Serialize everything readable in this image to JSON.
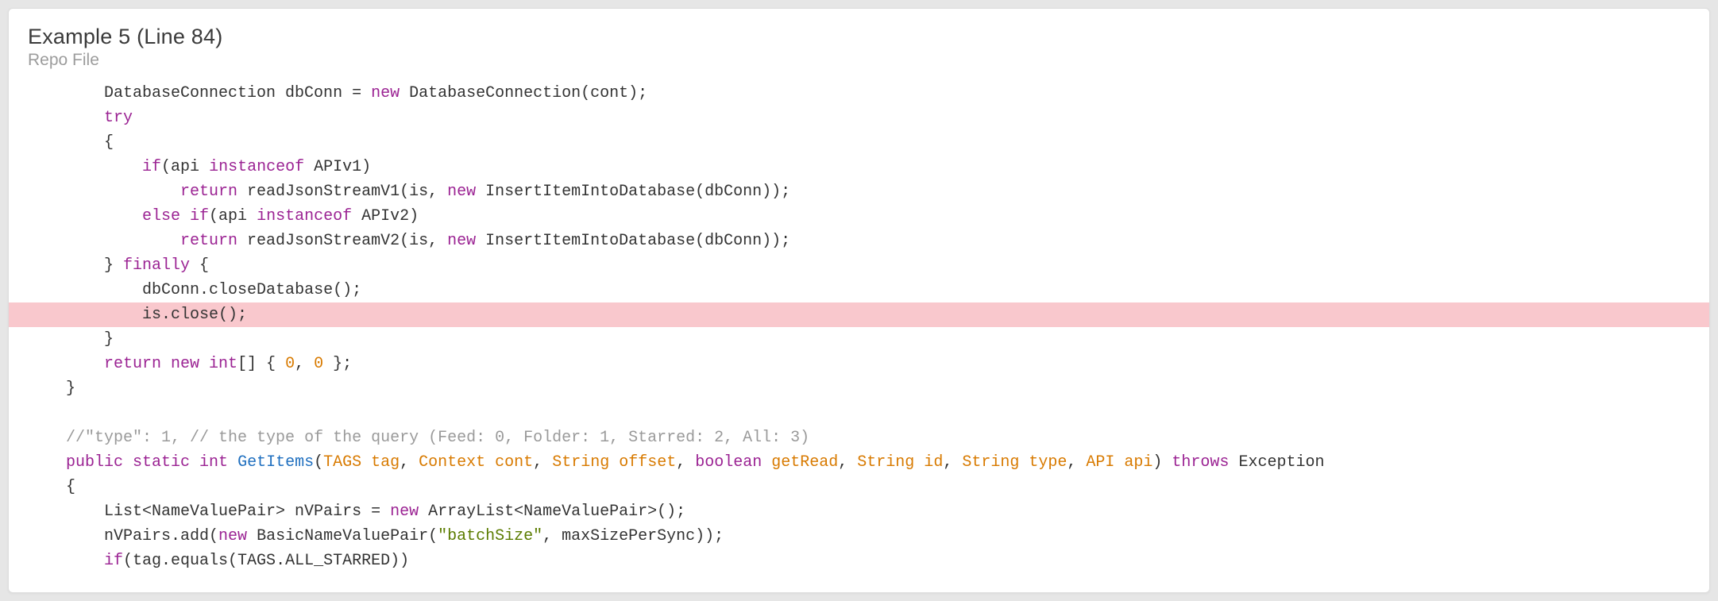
{
  "header": {
    "title": "Example 5 (Line 84)",
    "subtitle": "Repo File"
  },
  "code": {
    "lines": [
      {
        "indent": "        ",
        "highlight": false,
        "tokens": [
          {
            "t": "DatabaseConnection dbConn = ",
            "c": ""
          },
          {
            "t": "new",
            "c": "kw"
          },
          {
            "t": " DatabaseConnection(cont);",
            "c": ""
          }
        ]
      },
      {
        "indent": "        ",
        "highlight": false,
        "tokens": [
          {
            "t": "try",
            "c": "kw"
          }
        ]
      },
      {
        "indent": "        ",
        "highlight": false,
        "tokens": [
          {
            "t": "{",
            "c": ""
          }
        ]
      },
      {
        "indent": "            ",
        "highlight": false,
        "tokens": [
          {
            "t": "if",
            "c": "kw"
          },
          {
            "t": "(api ",
            "c": ""
          },
          {
            "t": "instanceof",
            "c": "kw"
          },
          {
            "t": " APIv1)",
            "c": ""
          }
        ]
      },
      {
        "indent": "                ",
        "highlight": false,
        "tokens": [
          {
            "t": "return",
            "c": "kw"
          },
          {
            "t": " readJsonStreamV1(is, ",
            "c": ""
          },
          {
            "t": "new",
            "c": "kw"
          },
          {
            "t": " InsertItemIntoDatabase(dbConn));",
            "c": ""
          }
        ]
      },
      {
        "indent": "            ",
        "highlight": false,
        "tokens": [
          {
            "t": "else if",
            "c": "kw"
          },
          {
            "t": "(api ",
            "c": ""
          },
          {
            "t": "instanceof",
            "c": "kw"
          },
          {
            "t": " APIv2)",
            "c": ""
          }
        ]
      },
      {
        "indent": "                ",
        "highlight": false,
        "tokens": [
          {
            "t": "return",
            "c": "kw"
          },
          {
            "t": " readJsonStreamV2(is, ",
            "c": ""
          },
          {
            "t": "new",
            "c": "kw"
          },
          {
            "t": " InsertItemIntoDatabase(dbConn));",
            "c": ""
          }
        ]
      },
      {
        "indent": "        ",
        "highlight": false,
        "tokens": [
          {
            "t": "} ",
            "c": ""
          },
          {
            "t": "finally",
            "c": "kw"
          },
          {
            "t": " {",
            "c": ""
          }
        ]
      },
      {
        "indent": "            ",
        "highlight": false,
        "tokens": [
          {
            "t": "dbConn.closeDatabase();",
            "c": ""
          }
        ]
      },
      {
        "indent": "            ",
        "highlight": true,
        "tokens": [
          {
            "t": "is.close();",
            "c": ""
          }
        ]
      },
      {
        "indent": "        ",
        "highlight": false,
        "tokens": [
          {
            "t": "}",
            "c": ""
          }
        ]
      },
      {
        "indent": "        ",
        "highlight": false,
        "tokens": [
          {
            "t": "return new int",
            "c": "kw"
          },
          {
            "t": "[] { ",
            "c": ""
          },
          {
            "t": "0",
            "c": "num"
          },
          {
            "t": ", ",
            "c": ""
          },
          {
            "t": "0",
            "c": "num"
          },
          {
            "t": " };",
            "c": ""
          }
        ]
      },
      {
        "indent": "    ",
        "highlight": false,
        "tokens": [
          {
            "t": "}",
            "c": ""
          }
        ]
      },
      {
        "indent": "",
        "highlight": false,
        "tokens": []
      },
      {
        "indent": "    ",
        "highlight": false,
        "tokens": [
          {
            "t": "//\"type\": 1, // the type of the query (Feed: 0, Folder: 1, Starred: 2, All: 3)",
            "c": "comment"
          }
        ]
      },
      {
        "indent": "    ",
        "highlight": false,
        "tokens": [
          {
            "t": "public static int",
            "c": "kw"
          },
          {
            "t": " ",
            "c": ""
          },
          {
            "t": "GetItems",
            "c": "func"
          },
          {
            "t": "(",
            "c": ""
          },
          {
            "t": "TAGS tag",
            "c": "param"
          },
          {
            "t": ", ",
            "c": ""
          },
          {
            "t": "Context cont",
            "c": "param"
          },
          {
            "t": ", ",
            "c": ""
          },
          {
            "t": "String offset",
            "c": "param"
          },
          {
            "t": ", ",
            "c": ""
          },
          {
            "t": "boolean",
            "c": "kw"
          },
          {
            "t": " ",
            "c": ""
          },
          {
            "t": "getRead",
            "c": "param"
          },
          {
            "t": ", ",
            "c": ""
          },
          {
            "t": "String id",
            "c": "param"
          },
          {
            "t": ", ",
            "c": ""
          },
          {
            "t": "String type",
            "c": "param"
          },
          {
            "t": ", ",
            "c": ""
          },
          {
            "t": "API api",
            "c": "param"
          },
          {
            "t": ") ",
            "c": ""
          },
          {
            "t": "throws",
            "c": "kw"
          },
          {
            "t": " Exception",
            "c": ""
          }
        ]
      },
      {
        "indent": "    ",
        "highlight": false,
        "tokens": [
          {
            "t": "{",
            "c": ""
          }
        ]
      },
      {
        "indent": "        ",
        "highlight": false,
        "tokens": [
          {
            "t": "List<NameValuePair> nVPairs = ",
            "c": ""
          },
          {
            "t": "new",
            "c": "kw"
          },
          {
            "t": " ArrayList<NameValuePair>();",
            "c": ""
          }
        ]
      },
      {
        "indent": "        ",
        "highlight": false,
        "tokens": [
          {
            "t": "nVPairs.add(",
            "c": ""
          },
          {
            "t": "new",
            "c": "kw"
          },
          {
            "t": " BasicNameValuePair(",
            "c": ""
          },
          {
            "t": "\"batchSize\"",
            "c": "str"
          },
          {
            "t": ", maxSizePerSync));",
            "c": ""
          }
        ]
      },
      {
        "indent": "        ",
        "highlight": false,
        "tokens": [
          {
            "t": "if",
            "c": "kw"
          },
          {
            "t": "(tag.equals(TAGS.ALL_STARRED))",
            "c": ""
          }
        ]
      }
    ]
  }
}
